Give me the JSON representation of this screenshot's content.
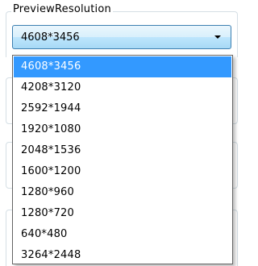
{
  "group": {
    "title": "PreviewResolution"
  },
  "combobox": {
    "selected_value": "4608*3456"
  },
  "dropdown": {
    "selected_index": 0,
    "options": [
      "4608*3456",
      "4208*3120",
      "2592*1944",
      "1920*1080",
      "2048*1536",
      "1600*1200",
      "1280*960",
      "1280*720",
      "640*480",
      "3264*2448"
    ]
  },
  "colors": {
    "selection_highlight": "#3399ff",
    "combobox_border": "#3c7fb1"
  },
  "icons": {
    "dropdown_arrow": "chevron-down-icon"
  }
}
